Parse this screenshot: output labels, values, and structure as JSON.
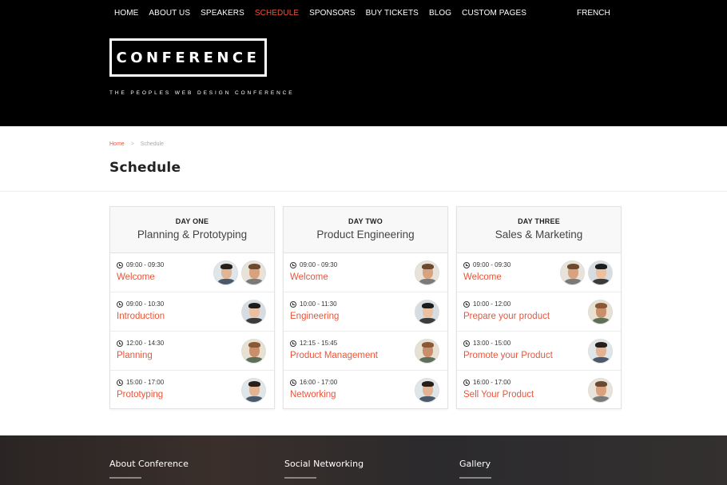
{
  "nav": {
    "items": [
      "HOME",
      "ABOUT US",
      "SPEAKERS",
      "SCHEDULE",
      "SPONSORS",
      "BUY TICKETS",
      "BLOG",
      "CUSTOM PAGES"
    ],
    "active": "SCHEDULE",
    "language": "FRENCH"
  },
  "brand": {
    "logo_text": "CONFERENCE",
    "tagline": "THE PEOPLES WEB DESIGN CONFERENCE"
  },
  "breadcrumb": {
    "home": "Home",
    "separator": ">",
    "current": "Schedule"
  },
  "page_title": "Schedule",
  "accent_color": "#e8553b",
  "days": [
    {
      "day": "DAY ONE",
      "topic": "Planning & Prototyping",
      "slots": [
        {
          "time": "09:00 - 09:30",
          "title": "Welcome",
          "speakers": 2
        },
        {
          "time": "09:00 - 10:30",
          "title": "Introduction",
          "speakers": 1
        },
        {
          "time": "12:00 - 14:30",
          "title": "Planning",
          "speakers": 1
        },
        {
          "time": "15:00 - 17:00",
          "title": "Prototyping",
          "speakers": 1
        }
      ]
    },
    {
      "day": "DAY TWO",
      "topic": "Product Engineering",
      "slots": [
        {
          "time": "09:00 - 09:30",
          "title": "Welcome",
          "speakers": 1
        },
        {
          "time": "10:00 - 11:30",
          "title": "Engineering",
          "speakers": 1
        },
        {
          "time": "12:15 - 15:45",
          "title": "Product Management",
          "speakers": 1
        },
        {
          "time": "16:00 - 17:00",
          "title": "Networking",
          "speakers": 1
        }
      ]
    },
    {
      "day": "DAY THREE",
      "topic": "Sales & Marketing",
      "slots": [
        {
          "time": "09:00 - 09:30",
          "title": "Welcome",
          "speakers": 2
        },
        {
          "time": "10:00 - 12:00",
          "title": "Prepare your product",
          "speakers": 1
        },
        {
          "time": "13:00 - 15:00",
          "title": "Promote your Product",
          "speakers": 1
        },
        {
          "time": "16:00 - 17:00",
          "title": "Sell Your Product",
          "speakers": 1
        }
      ]
    }
  ],
  "footer": {
    "columns": [
      "About Conference",
      "Social Networking",
      "Gallery"
    ]
  }
}
